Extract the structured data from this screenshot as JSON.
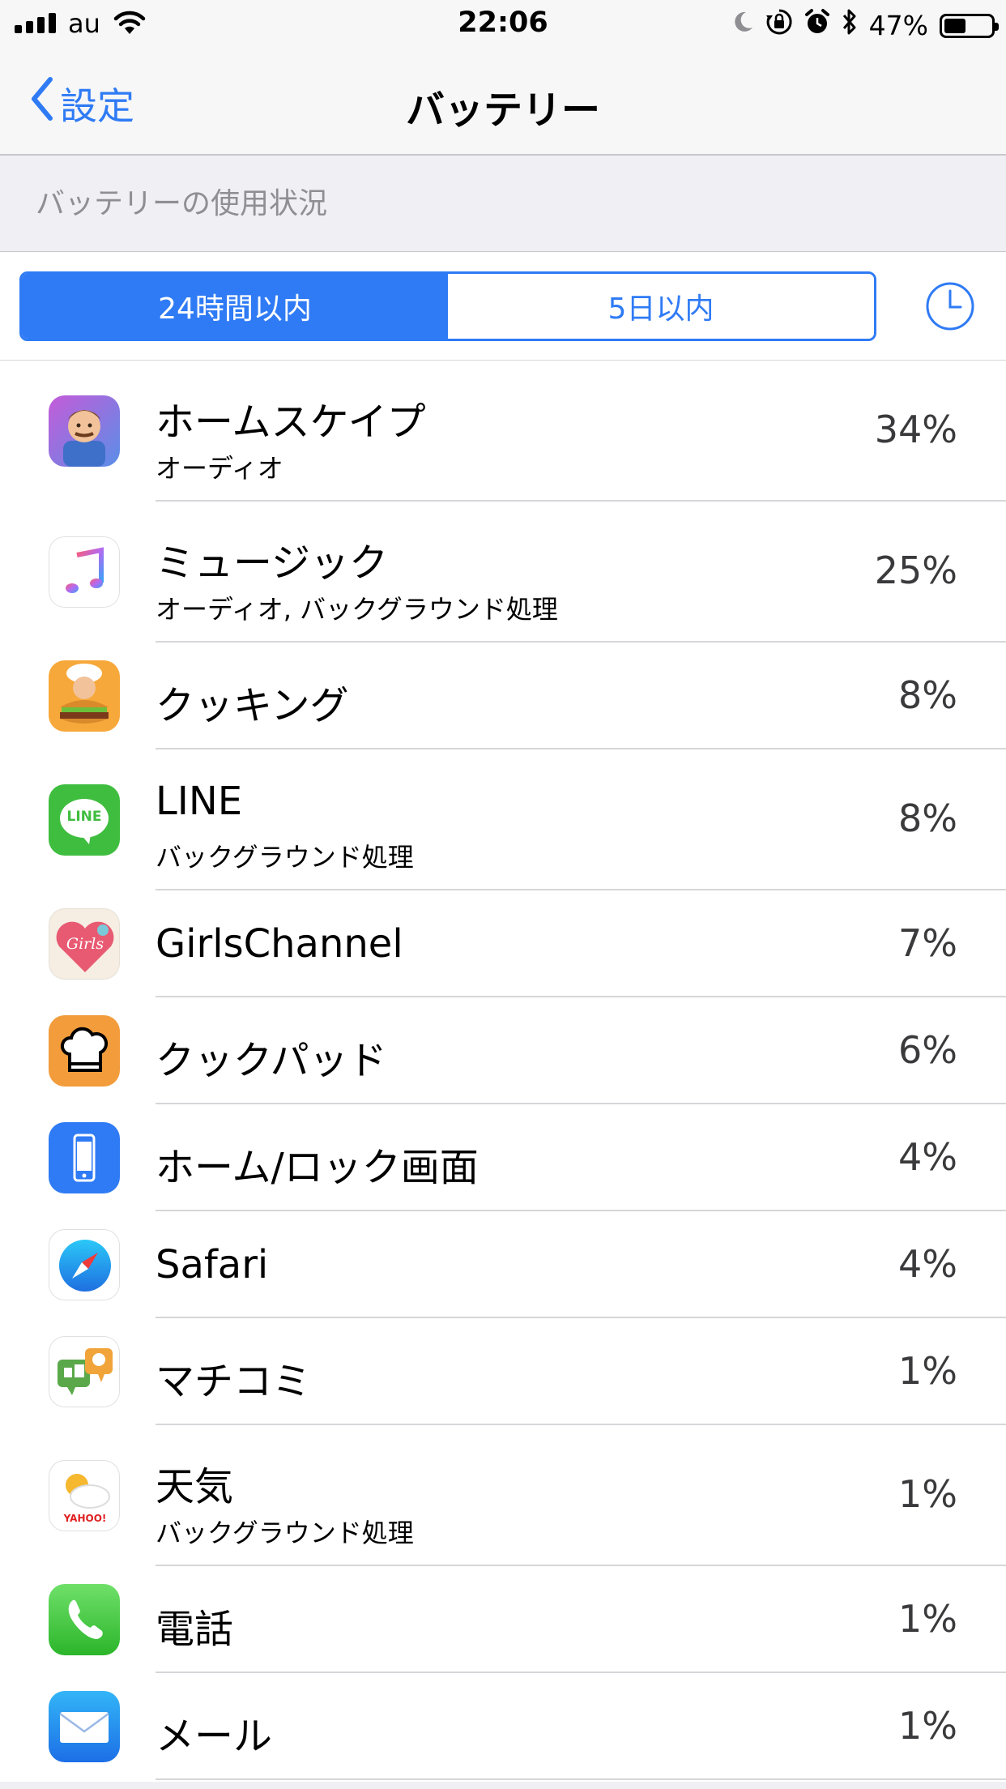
{
  "status_bar": {
    "carrier": "au",
    "time": "22:06",
    "battery_percent_label": "47%",
    "battery_level": 0.47,
    "icons": [
      "signal-icon",
      "wifi-icon",
      "moon-icon",
      "rotation-lock-icon",
      "alarm-icon",
      "bluetooth-icon",
      "battery-icon"
    ]
  },
  "nav": {
    "back_label": "設定",
    "title": "バッテリー"
  },
  "section": {
    "header": "バッテリーの使用状況"
  },
  "segments": {
    "items": [
      "24時間以内",
      "5日以内"
    ],
    "selected": "24時間以内"
  },
  "apps": [
    {
      "name": "ホームスケイプ",
      "detail": "オーディオ",
      "percent": "34%",
      "icon": "homescapes-icon"
    },
    {
      "name": "ミュージック",
      "detail": "オーディオ, バックグラウンド処理",
      "percent": "25%",
      "icon": "music-icon"
    },
    {
      "name": "クッキング",
      "detail": "",
      "percent": "8%",
      "icon": "cooking-icon"
    },
    {
      "name": "LINE",
      "detail": "バックグラウンド処理",
      "percent": "8%",
      "icon": "line-icon",
      "icon_text": "LINE"
    },
    {
      "name": "GirlsChannel",
      "detail": "",
      "percent": "7%",
      "icon": "girlschannel-icon",
      "icon_text": "Girls"
    },
    {
      "name": "クックパッド",
      "detail": "",
      "percent": "6%",
      "icon": "cookpad-icon"
    },
    {
      "name": "ホーム/ロック画面",
      "detail": "",
      "percent": "4%",
      "icon": "home-lock-screen-icon"
    },
    {
      "name": "Safari",
      "detail": "",
      "percent": "4%",
      "icon": "safari-icon"
    },
    {
      "name": "マチコミ",
      "detail": "",
      "percent": "1%",
      "icon": "machikomi-icon"
    },
    {
      "name": "天気",
      "detail": "バックグラウンド処理",
      "percent": "1%",
      "icon": "weather-icon",
      "icon_text": "YAHOO!"
    },
    {
      "name": "電話",
      "detail": "",
      "percent": "1%",
      "icon": "phone-icon"
    },
    {
      "name": "メール",
      "detail": "",
      "percent": "1%",
      "icon": "mail-icon"
    }
  ],
  "colors": {
    "accent": "#2f7bf5",
    "background": "#efeff4",
    "separator": "#d6d6da"
  }
}
